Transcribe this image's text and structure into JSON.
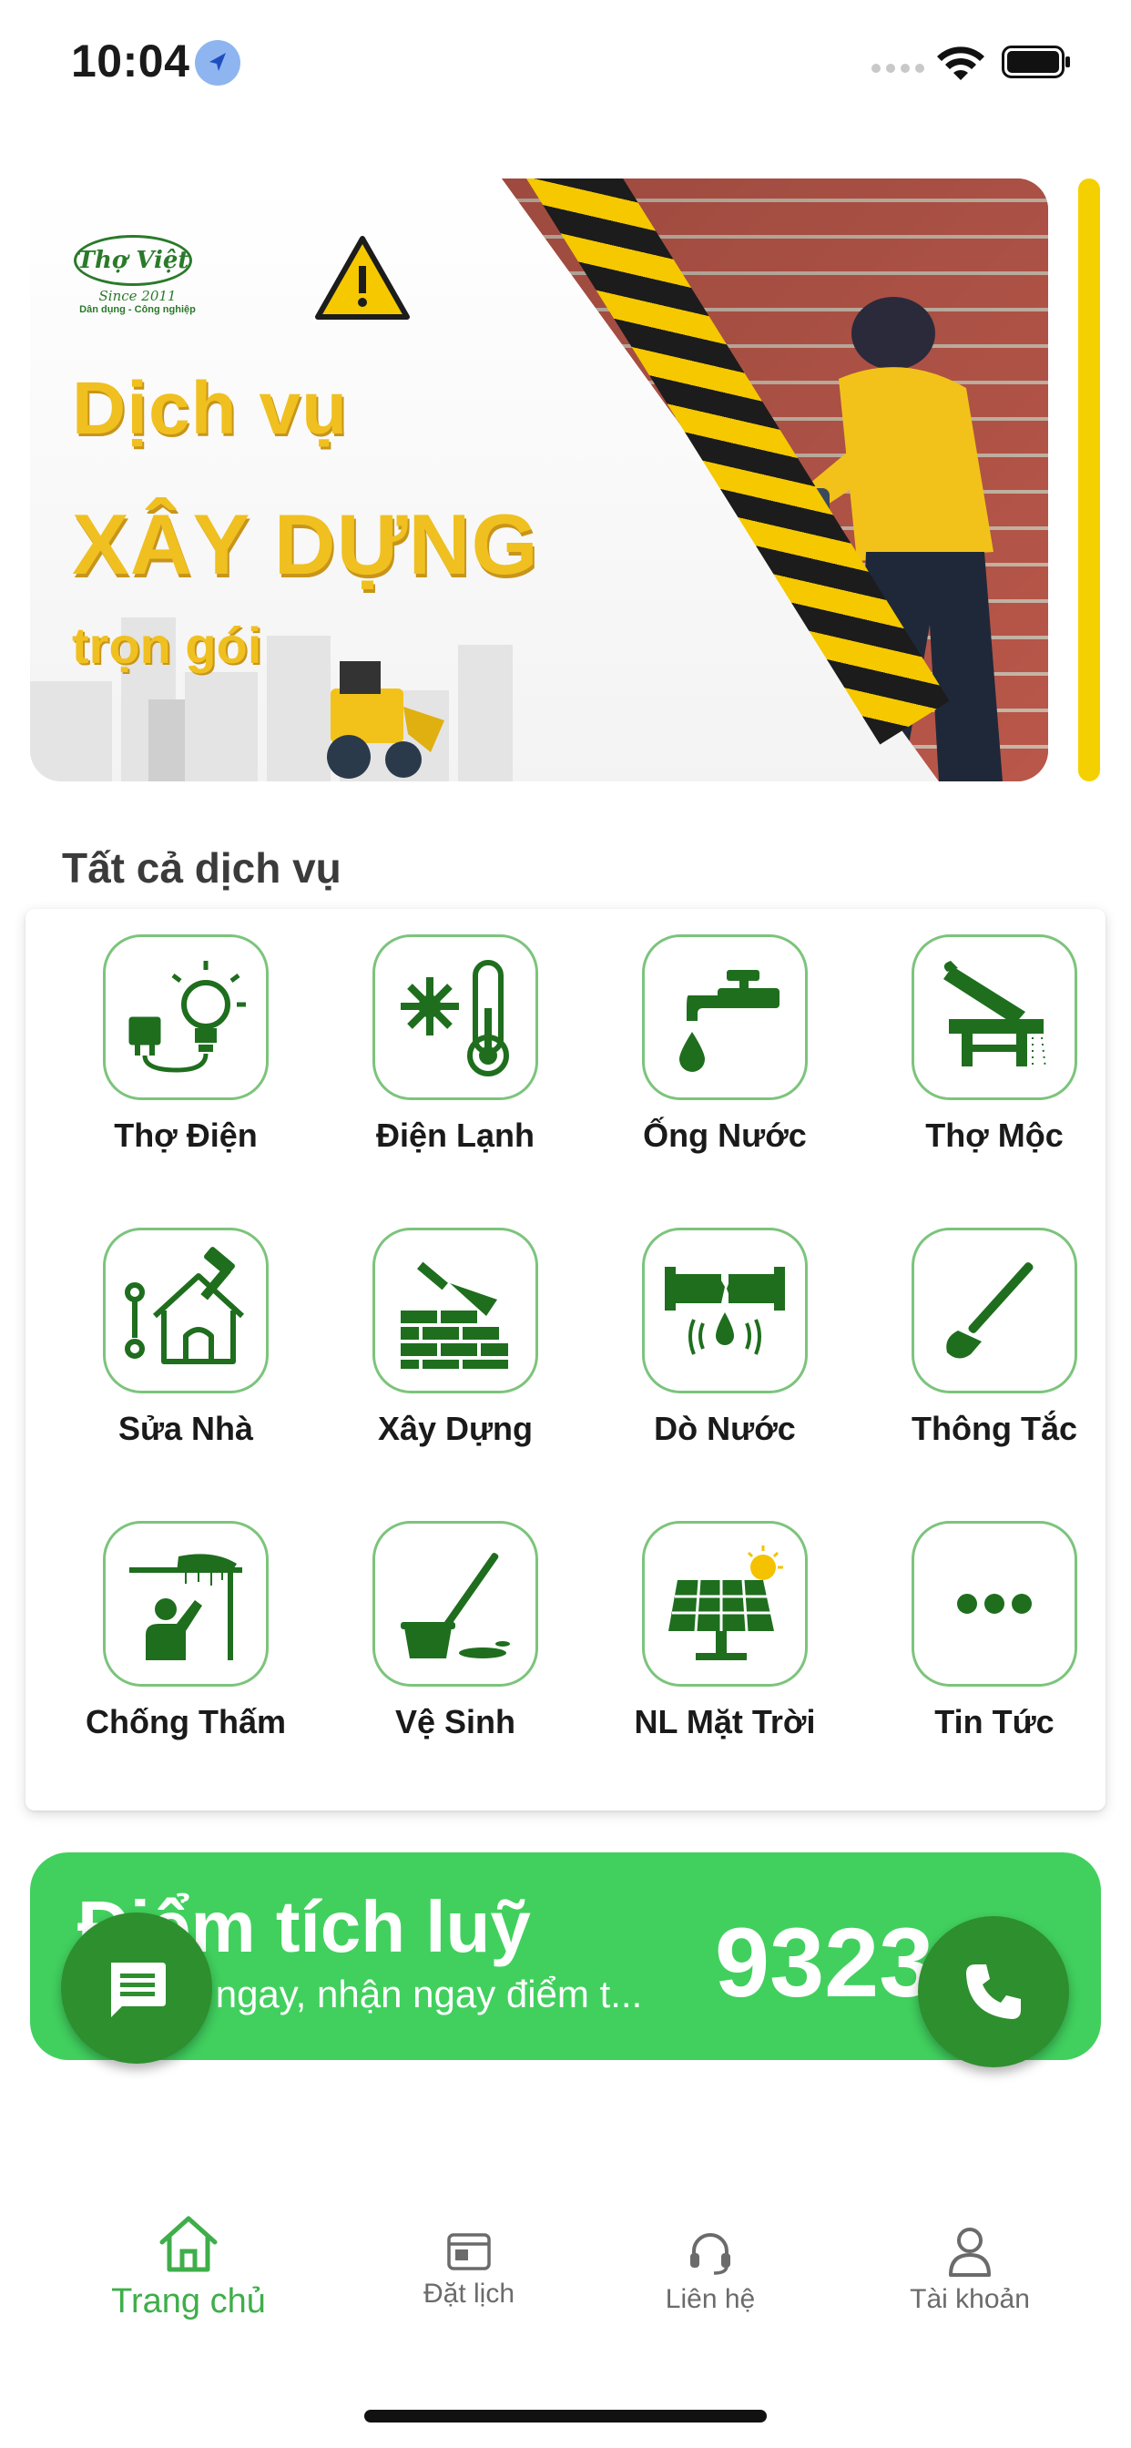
{
  "status_bar": {
    "time": "10:04",
    "location_icon": "location-arrow-icon",
    "signal_icon": "cellular-signal-icon",
    "wifi_icon": "wifi-icon",
    "battery_icon": "battery-icon"
  },
  "banner": {
    "logo_text": "Thợ Việt",
    "logo_since": "Since 2011",
    "logo_subtitle": "Dân dụng - Công nghiệp",
    "line1": "Dịch vụ",
    "line2": "XÂY DỰNG",
    "line3": "trọn gói"
  },
  "services_section": {
    "title": "Tất cả dịch vụ",
    "items": [
      {
        "label": "Thợ Điện",
        "icon": "electrician-icon"
      },
      {
        "label": "Điện Lạnh",
        "icon": "refrigeration-icon"
      },
      {
        "label": "Ống Nước",
        "icon": "water-tap-icon"
      },
      {
        "label": "Thợ Mộc",
        "icon": "carpenter-saw-icon"
      },
      {
        "label": "Sửa Nhà",
        "icon": "house-repair-icon"
      },
      {
        "label": "Xây Dựng",
        "icon": "brick-wall-trowel-icon"
      },
      {
        "label": "Dò Nước",
        "icon": "pipe-leak-icon"
      },
      {
        "label": "Thông Tắc",
        "icon": "plunger-icon"
      },
      {
        "label": "Chống Thấm",
        "icon": "waterproofing-icon"
      },
      {
        "label": "Vệ Sinh",
        "icon": "mop-bucket-icon"
      },
      {
        "label": "NL Mặt Trời",
        "icon": "solar-panel-icon"
      },
      {
        "label": "Tin Tức",
        "icon": "more-dots-icon"
      }
    ]
  },
  "points": {
    "title": "Điểm tích luỹ",
    "subtitle": "Đặt lịch ngay, nhận ngay điểm t...",
    "value": "9323"
  },
  "fabs": {
    "chat_icon": "chat-icon",
    "call_icon": "phone-icon"
  },
  "bottom_nav": {
    "items": [
      {
        "label": "Trang chủ",
        "icon": "home-icon",
        "active": true
      },
      {
        "label": "Đặt lịch",
        "icon": "calendar-icon",
        "active": false
      },
      {
        "label": "Liên hệ",
        "icon": "headset-icon",
        "active": false
      },
      {
        "label": "Tài khoản",
        "icon": "user-icon",
        "active": false
      }
    ]
  },
  "colors": {
    "brand_green": "#41d05e",
    "dark_green": "#1e6e1e",
    "fab_green": "#2e8f2e",
    "icon_border": "#7cc47c",
    "banner_yellow": "#f0c020",
    "active_nav": "#3fae4a"
  }
}
